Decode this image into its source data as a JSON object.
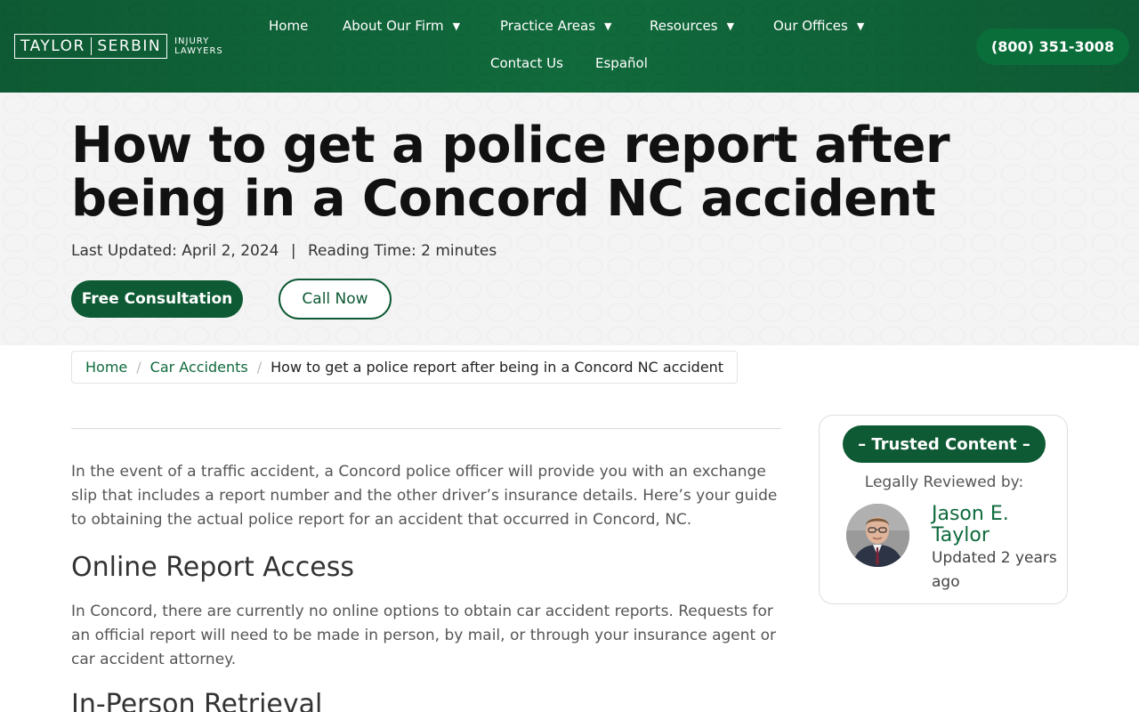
{
  "header": {
    "logo": {
      "name_left": "TAYLOR",
      "name_right": "SERBIN",
      "sub_line1": "INJURY",
      "sub_line2": "LAWYERS"
    },
    "nav": [
      {
        "label": "Home",
        "has_dropdown": false
      },
      {
        "label": "About Our Firm",
        "has_dropdown": true
      },
      {
        "label": "Practice Areas",
        "has_dropdown": true
      },
      {
        "label": "Resources",
        "has_dropdown": true
      },
      {
        "label": "Our Offices",
        "has_dropdown": true
      },
      {
        "label": "Contact Us",
        "has_dropdown": false
      },
      {
        "label": "Español",
        "has_dropdown": false
      }
    ],
    "phone": "(800) 351-3008",
    "colors": {
      "brand_green": "#0e5a34",
      "link_green": "#0e6a3c"
    }
  },
  "hero": {
    "title": "How to get a police report after being in a Concord NC accident",
    "last_updated": "Last Updated: April 2, 2024",
    "separator": "|",
    "reading_time": "Reading Time: 2 minutes",
    "btn_consult": "Free Consultation",
    "btn_call": "Call Now"
  },
  "breadcrumb": {
    "items": [
      {
        "label": "Home",
        "link": true
      },
      {
        "label": "Car Accidents",
        "link": true
      },
      {
        "label": "How to get a police report after being in a Concord NC accident",
        "link": false
      }
    ],
    "separator": "/"
  },
  "article": {
    "intro": "In the event of a traffic accident, a Concord police officer will provide you with an exchange slip that includes a report number and the other driver’s insurance details. Here’s your guide to obtaining the actual police report for an accident that occurred in Concord, NC.",
    "h2_online": "Online Report Access",
    "online_text": "In Concord, there are currently no online options to obtain car accident reports. Requests for an official report will need to be made in person, by mail, or through your insurance agent or car accident attorney.",
    "h2_in_person": "In-Person Retrieval"
  },
  "sidebar": {
    "badge": "– Trusted Content –",
    "reviewed_by": "Legally Reviewed by:",
    "author_line1": "Jason E.",
    "author_line2": "Taylor",
    "updated": "Updated 2 years ago"
  }
}
